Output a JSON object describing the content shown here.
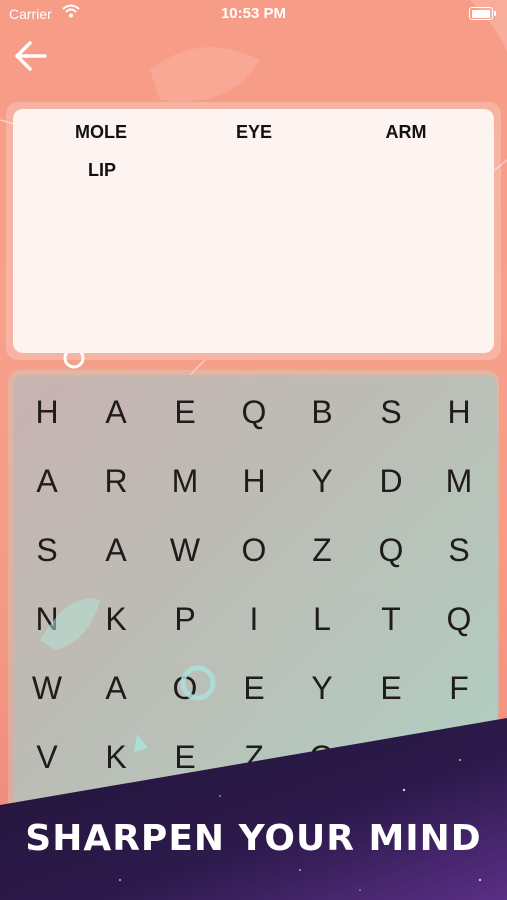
{
  "status_bar": {
    "carrier": "Carrier",
    "time": "10:53 PM"
  },
  "words": [
    "MOLE",
    "EYE",
    "ARM",
    "LIP"
  ],
  "grid": [
    [
      "H",
      "A",
      "E",
      "Q",
      "B",
      "S",
      "H"
    ],
    [
      "A",
      "R",
      "M",
      "H",
      "Y",
      "D",
      "M"
    ],
    [
      "S",
      "A",
      "W",
      "O",
      "Z",
      "Q",
      "S"
    ],
    [
      "N",
      "K",
      "P",
      "I",
      "L",
      "T",
      "Q"
    ],
    [
      "W",
      "A",
      "O",
      "E",
      "Y",
      "E",
      "F"
    ],
    [
      "V",
      "K",
      "E",
      "Z",
      "O",
      "",
      ""
    ]
  ],
  "banner": {
    "tagline": "SHARPEN YOUR MIND"
  },
  "colors": {
    "background": "#f79c86",
    "banner": "#2e1a4a",
    "grid": "#b7c9c0"
  }
}
